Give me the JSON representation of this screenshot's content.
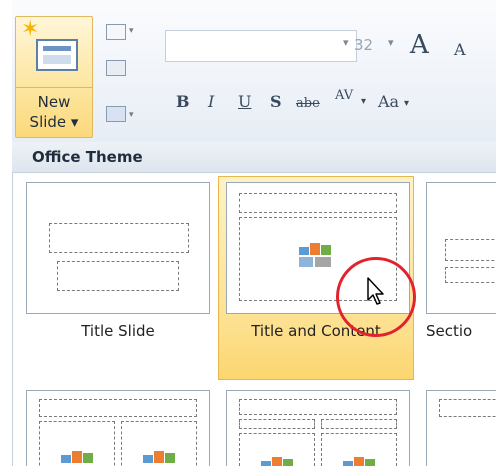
{
  "ribbon": {
    "new_slide": {
      "line1": "New",
      "line2": "Slide ▾"
    },
    "font": {
      "name": "",
      "size": "32",
      "grow_label": "A",
      "shrink_label": "A"
    },
    "format_buttons": [
      {
        "name": "bold-button",
        "label": "B"
      },
      {
        "name": "italic-button",
        "label": "I"
      },
      {
        "name": "underline-button",
        "label": "U"
      },
      {
        "name": "shadow-button",
        "label": "S"
      },
      {
        "name": "strikethrough-button",
        "label": "abe"
      },
      {
        "name": "char-spacing-button",
        "label": "AV"
      },
      {
        "name": "change-case-button",
        "label": "Aa"
      }
    ]
  },
  "gallery": {
    "header": "Office Theme",
    "layouts": [
      {
        "label": "Title Slide"
      },
      {
        "label": "Title and Content"
      },
      {
        "label": "Sectio"
      }
    ]
  },
  "colors": {
    "selected": "#fde08e",
    "highlight_circle": "#e0232d",
    "accent_border": "#e1b85b"
  }
}
